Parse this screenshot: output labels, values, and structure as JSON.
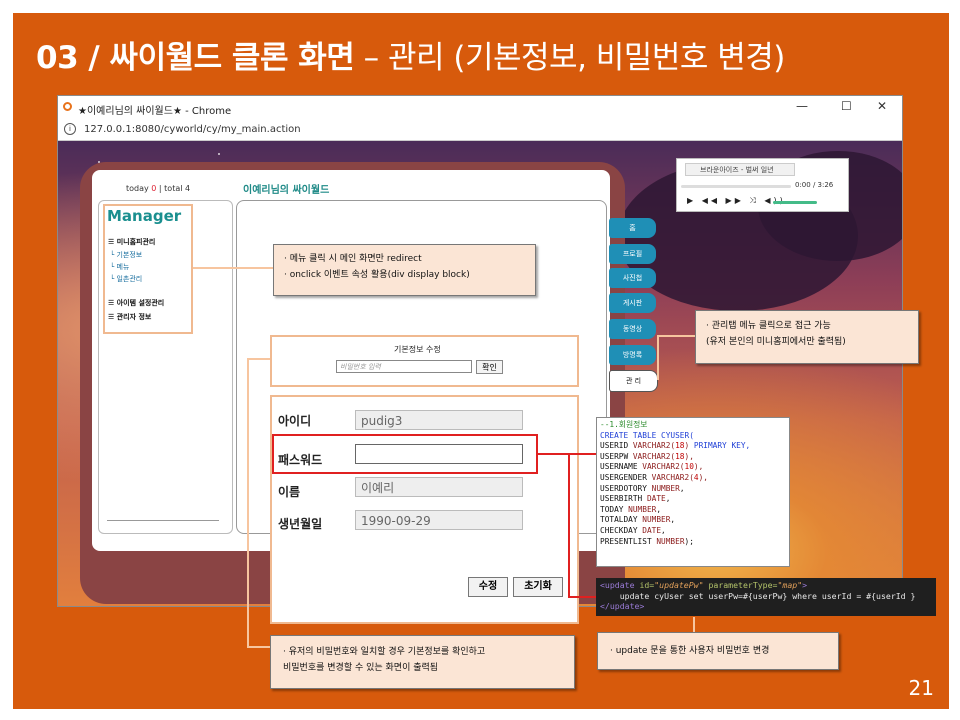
{
  "slide": {
    "title_bold": "03 / 싸이월드 클론 화면",
    "title_rest": " – 관리 (기본정보, 비밀번호 변경)",
    "page_number": "21"
  },
  "browser": {
    "window_title": "★이예리님의 싸이월드★ - Chrome",
    "url": "127.0.0.1:8080/cyworld/cy/my_main.action",
    "minimize": "—",
    "maximize": "☐",
    "close": "✕"
  },
  "homepage": {
    "today_label": "today ",
    "today_count": "0",
    "total_label": " | total 4",
    "title": "이예리님의 싸이월드"
  },
  "sidebar": {
    "heading": "Manager",
    "group1": "미니홈피관리",
    "sub_items": [
      "기본정보",
      "메뉴",
      "일촌관리"
    ],
    "group2": "아이템 설정관리",
    "group3": "관리자 정보"
  },
  "nav_tabs": [
    "홈",
    "프로필",
    "사진첩",
    "게시판",
    "동영상",
    "방명록",
    "관 리"
  ],
  "music_player": {
    "song": "브라운아이즈 - 벌써 일년",
    "time": "0:00 / 3:26",
    "controls": "▶ ◀◀ ▶▶ ⤨ ◀))"
  },
  "password_check": {
    "title": "기본정보 수정",
    "placeholder": "비밀번호 입력",
    "confirm_button": "확인"
  },
  "profile_form": {
    "id_label": "아이디",
    "id_value": "pudig3",
    "pw_label": "패스워드",
    "pw_value": "",
    "name_label": "이름",
    "name_value": "이예리",
    "birth_label": "생년월일",
    "birth_value": "1990-09-29",
    "edit_button": "수정",
    "reset_button": "초기화"
  },
  "callouts": {
    "menu_line1": "· 메뉴 클릭 시 메인 화면만 redirect",
    "menu_line2": "· onclick 이벤트 속성 활용(div display block)",
    "admin_line1": "· 관리탭 메뉴 클릭으로 접근 가능",
    "admin_line2": "(유저 본인의 미니홈피에서만 출력됨)",
    "verify_line1": "· 유저의 비밀번호와 일치할 경우 기본정보를 확인하고",
    "verify_line2": "비밀번호를 변경할 수 있는 화면이 출력됨",
    "update_note": "· update 문을 통한 사용자 비밀번호 변경"
  },
  "sql": {
    "comment": "--1.회원정보",
    "create": "CREATE TABLE CYUSER(",
    "c1_name": "USERID ",
    "c1_type": "VARCHAR2(",
    "c1_len": "18",
    "c1_end": ") ",
    "c1_pk": "PRIMARY KEY,",
    "c2_name": "USERPW ",
    "c2_type": "VARCHAR2(",
    "c2_len": "18",
    "c2_end": "),",
    "c3_name": "USERNAME ",
    "c3_type": "VARCHAR2(",
    "c3_len": "10",
    "c3_end": "),",
    "c4_name": "USERGENDER ",
    "c4_type": "VARCHAR2(",
    "c4_len": "4",
    "c4_end": "),",
    "c5_name": "USERDOTORY ",
    "c5_type": "NUMBER",
    "c5_end": ",",
    "c6_name": "USERBIRTH ",
    "c6_type": "DATE",
    "c6_end": ",",
    "c7_name": "TODAY ",
    "c7_type": "NUMBER",
    "c7_end": ",",
    "c8_name": "TOTALDAY ",
    "c8_type": "NUMBER",
    "c8_end": ",",
    "c9_name": "CHECKDAY ",
    "c9_type": "DATE",
    "c9_end": ",",
    "c10_name": "PRESENTLIST ",
    "c10_type": "NUMBER",
    "c10_end": ");"
  },
  "mybatis": {
    "open_tag": "<update ",
    "id_attr": "id=",
    "id_val": "\"updatePw\"",
    "ptype_attr": " parameterType=",
    "ptype_val": "\"map\"",
    "open_end": ">",
    "statement": "    update cyUser set userPw=#{userPw} where userId = #{userId }",
    "close_tag": "</update>"
  }
}
